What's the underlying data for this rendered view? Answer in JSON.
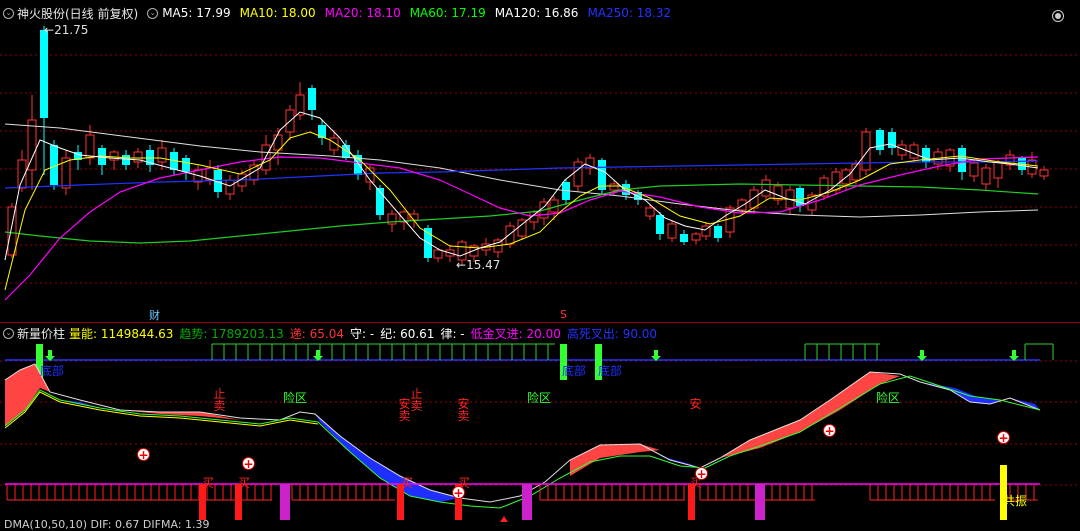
{
  "main": {
    "title": "神火股份(日线 前复权)",
    "ma_items": [
      {
        "label": "MA5: 17.99",
        "color": "#ffffff"
      },
      {
        "label": "MA10: 18.00",
        "color": "#ffff00"
      },
      {
        "label": "MA20: 18.10",
        "color": "#ff00ff"
      },
      {
        "label": "MA60: 17.19",
        "color": "#00ff00"
      },
      {
        "label": "MA120: 16.86",
        "color": "#ffffff"
      },
      {
        "label": "MA250: 18.32",
        "color": "#0000ff"
      }
    ],
    "high_label": "21.75",
    "low_label": "15.47",
    "marker_cai": "财",
    "marker_s": "S"
  },
  "sub": {
    "title": "新量价柱",
    "items": [
      {
        "label": "量能: 1149844.63",
        "color": "#ffff00"
      },
      {
        "label": "趋势: 1789203.13",
        "color": "#00aa00"
      },
      {
        "label": "递: 65.04",
        "color": "#ff3333"
      },
      {
        "label": "守: -",
        "color": "#ffffff"
      },
      {
        "label": "纪: 60.61",
        "color": "#ffffff"
      },
      {
        "label": "律: -",
        "color": "#ffffff"
      },
      {
        "label": "低金叉进: 20.00",
        "color": "#ff00ff"
      },
      {
        "label": "高死叉出: 90.00",
        "color": "#0000ff"
      }
    ],
    "labels": {
      "bottom_area": "底部",
      "danger_zone": "险区",
      "sell": "卖",
      "stop": "止",
      "safe": "安",
      "buy": "买",
      "resonance": "共振"
    }
  },
  "bottom": {
    "text": "DMA(10,50,10)  DIF: 0.67  DIFMA: 1.39"
  },
  "colors": {
    "up": "#ff3333",
    "down": "#00ffff",
    "grid": "#990000"
  }
}
